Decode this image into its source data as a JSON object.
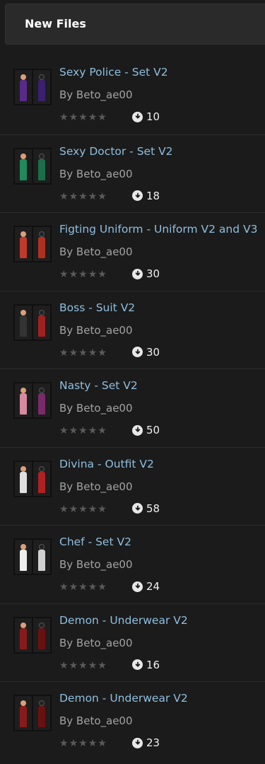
{
  "header": {
    "title": "New Files"
  },
  "rating_icon": "star-icon",
  "download_icon": "download-circle-icon",
  "files": [
    {
      "title": "Sexy Police - Set V2",
      "author": "By Beto_ae00",
      "downloads": "10",
      "rating": 0,
      "colors": [
        "#5a2a8a",
        "#3a2070"
      ]
    },
    {
      "title": "Sexy Doctor - Set V2",
      "author": "By Beto_ae00",
      "downloads": "18",
      "rating": 0,
      "colors": [
        "#1f8a5a",
        "#1a6e4a"
      ]
    },
    {
      "title": "Figting Uniform - Uniform V2 and V3",
      "author": "By Beto_ae00",
      "downloads": "30",
      "rating": 0,
      "colors": [
        "#c0392b",
        "#b0301f"
      ]
    },
    {
      "title": "Boss - Suit V2",
      "author": "By Beto_ae00",
      "downloads": "30",
      "rating": 0,
      "colors": [
        "#333333",
        "#a02020"
      ]
    },
    {
      "title": "Nasty - Set V2",
      "author": "By Beto_ae00",
      "downloads": "50",
      "rating": 0,
      "colors": [
        "#d58aa0",
        "#7a2a6a"
      ]
    },
    {
      "title": "Divina - Outfit V2",
      "author": "By Beto_ae00",
      "downloads": "58",
      "rating": 0,
      "colors": [
        "#e0e0e0",
        "#b02020"
      ]
    },
    {
      "title": "Chef - Set V2",
      "author": "By Beto_ae00",
      "downloads": "24",
      "rating": 0,
      "colors": [
        "#eeeeee",
        "#d0d0d0"
      ]
    },
    {
      "title": "Demon - Underwear V2",
      "author": "By Beto_ae00",
      "downloads": "16",
      "rating": 0,
      "colors": [
        "#8a1a1a",
        "#6a1010"
      ]
    },
    {
      "title": "Demon - Underwear V2",
      "author": "By Beto_ae00",
      "downloads": "23",
      "rating": 0,
      "colors": [
        "#8a1a1a",
        "#6a1010"
      ]
    }
  ]
}
